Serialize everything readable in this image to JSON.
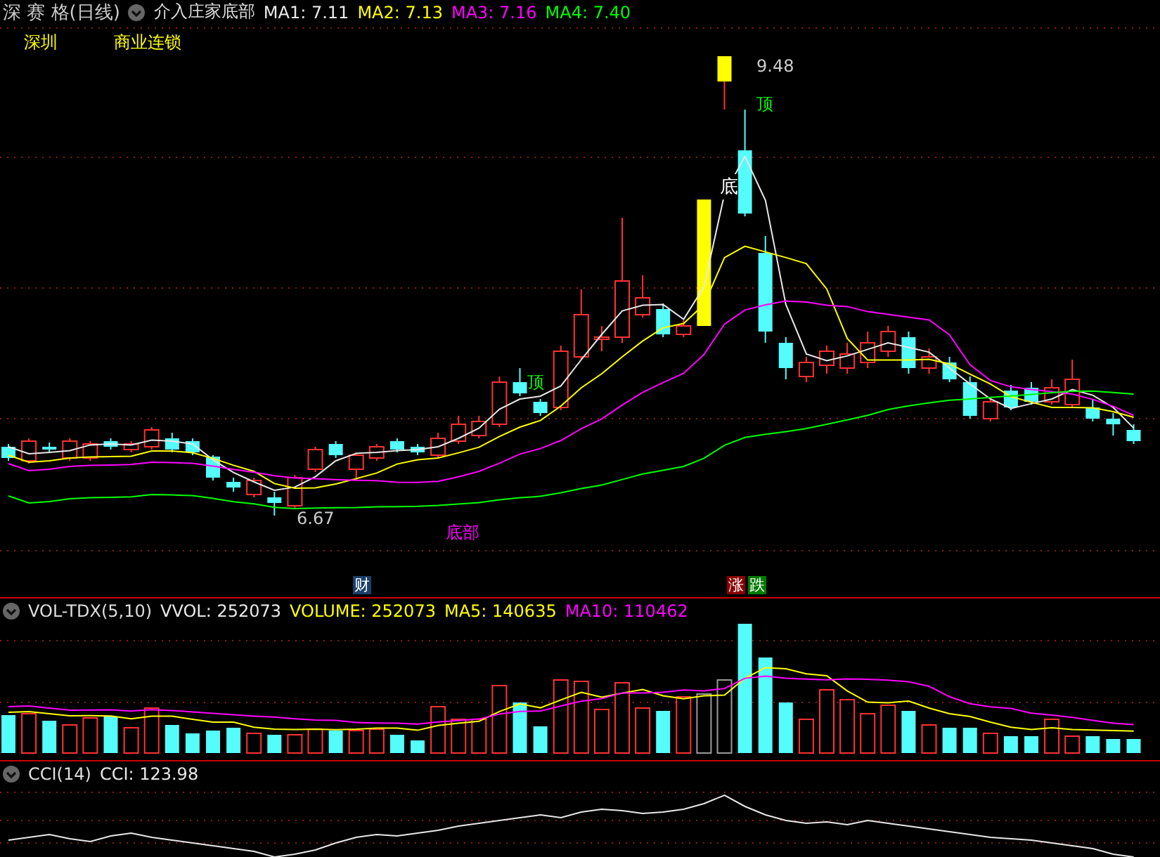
{
  "header": {
    "title": "深 赛 格(日线)",
    "indicator": "介入庄家底部",
    "values": [
      {
        "label": "MA1: 7.11",
        "color": "#e8e8e8"
      },
      {
        "label": "MA2: 7.13",
        "color": "#ffff00"
      },
      {
        "label": "MA3: 7.16",
        "color": "#ff00ff"
      },
      {
        "label": "MA4: 7.40",
        "color": "#00ff00"
      }
    ]
  },
  "tags": [
    "深圳",
    "商业连锁"
  ],
  "markers": [
    {
      "text": "9.48",
      "kind": "price"
    },
    {
      "text": "顶",
      "kind": "top"
    },
    {
      "text": "底",
      "kind": "bottom"
    },
    {
      "text": "顶",
      "kind": "top"
    },
    {
      "text": "6.67",
      "kind": "price"
    },
    {
      "text": "底部",
      "kind": "zone"
    }
  ],
  "badges": [
    {
      "text": "财",
      "kind": "finance"
    },
    {
      "text": "涨",
      "kind": "rise"
    },
    {
      "text": "跌",
      "kind": "fall"
    }
  ],
  "volume": {
    "name": "VOL-TDX(5,10)",
    "values": [
      {
        "label": "VVOL: 252073",
        "color": "#e8e8e8"
      },
      {
        "label": "VOLUME: 252073",
        "color": "#ffff00"
      },
      {
        "label": "MA5: 140635",
        "color": "#ffff00"
      },
      {
        "label": "MA10: 110462",
        "color": "#ff00ff"
      }
    ]
  },
  "cci": {
    "name": "CCI(14)",
    "values": [
      {
        "label": "CCI: 123.98",
        "color": "#e8e8e8"
      }
    ]
  }
}
